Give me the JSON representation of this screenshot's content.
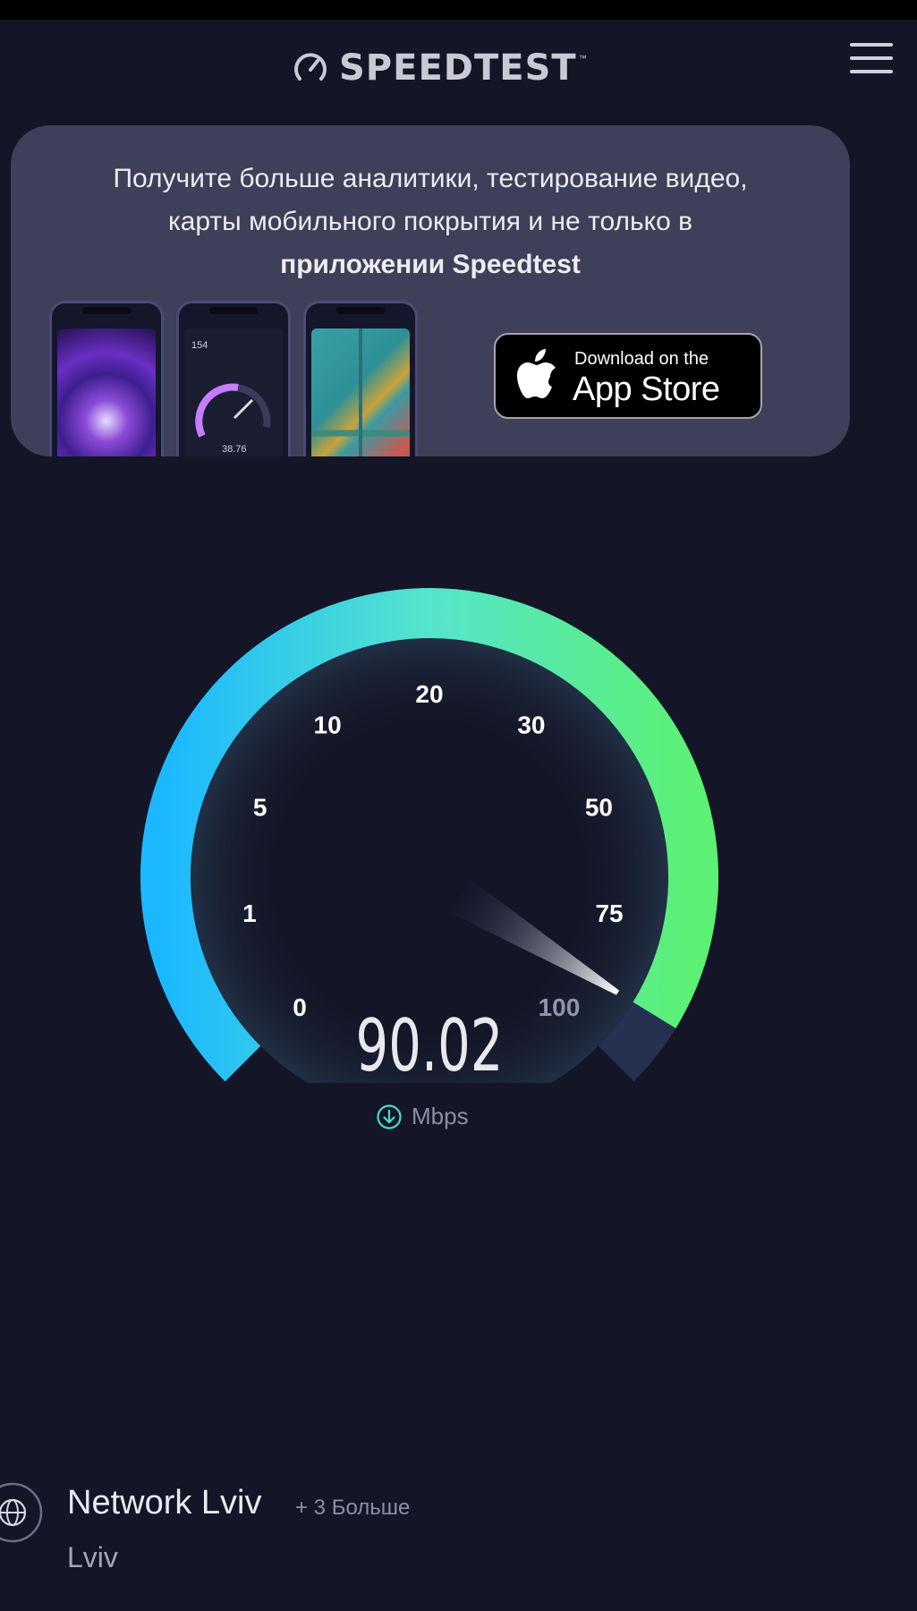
{
  "header": {
    "logo_text": "SPEEDTEST",
    "logo_tm": "™",
    "logo_icon": "gauge-icon",
    "menu_icon": "hamburger-menu-icon"
  },
  "promo": {
    "line1": "Получите больше аналитики, тестирование видео,",
    "line2": "карты мобильного покрытия и не только в",
    "line3_bold": "приложении Speedtest",
    "phone2_value_top": "154",
    "phone2_value_speed": "38.76",
    "appstore": {
      "line1": "Download on the",
      "line2": "App Store",
      "icon": "apple-icon"
    }
  },
  "gauge": {
    "ticks": [
      "0",
      "1",
      "5",
      "10",
      "20",
      "30",
      "50",
      "75",
      "100"
    ],
    "value": 90.02,
    "max": 100,
    "colors": {
      "start": "#1fb9ff",
      "mid": "#52e3c2",
      "end": "#5cf075",
      "unfilled": "#263050"
    }
  },
  "result": {
    "speed": "90.02",
    "unit": "Mbps",
    "icon": "download-arrow-icon"
  },
  "server": {
    "name": "Network Lviv",
    "more": "+ 3 Больше",
    "location": "Lviv",
    "icon": "globe-icon"
  }
}
